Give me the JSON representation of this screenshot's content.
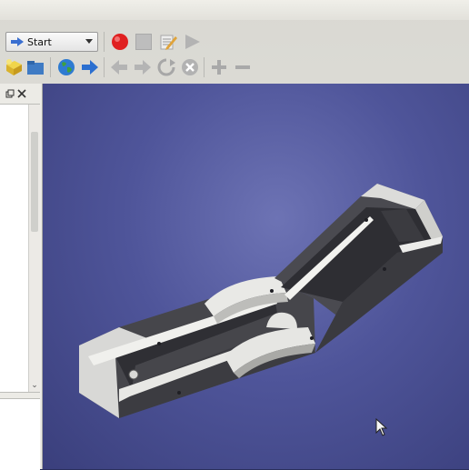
{
  "toolbar": {
    "workbench_selected": "Start",
    "icons_row1": [
      "workbench-arrow-icon",
      "record-macro-icon",
      "stop-macro-icon",
      "edit-macro-icon",
      "play-macro-icon"
    ],
    "icons_row2": [
      "new-document-icon",
      "open-folder-icon",
      "globe-icon",
      "forward-arrow-icon",
      "back-nav-icon",
      "forward-nav-icon",
      "refresh-icon",
      "stop-load-icon",
      "zoom-in-icon",
      "zoom-out-icon"
    ]
  },
  "panel": {
    "float_icon": "float-icon",
    "close_icon": "close-icon"
  },
  "colors": {
    "record": "#e02020",
    "view_background": "#4f559a",
    "model_face": "#e3e3e0",
    "model_dark": "#3a3a3e"
  }
}
